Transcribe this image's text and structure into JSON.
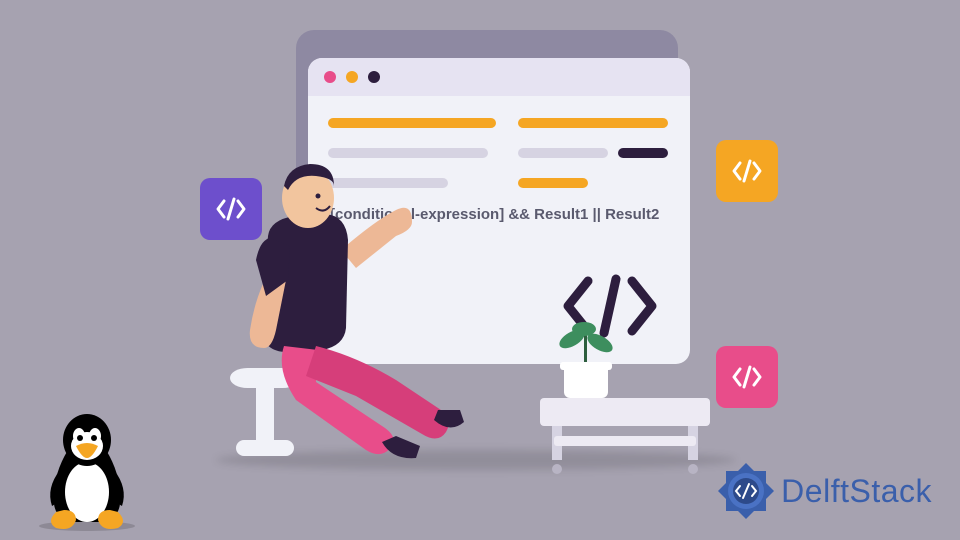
{
  "code_text": "[conditional-expression] && Result1 || Result2",
  "brand": {
    "name": "DelftStack"
  },
  "icons": {
    "code": "code-brackets-icon",
    "tux": "linux-tux-icon"
  },
  "colors": {
    "orange": "#F5A623",
    "purple": "#6D4FCC",
    "pink": "#E84D8A",
    "dark": "#2D1E3E"
  }
}
